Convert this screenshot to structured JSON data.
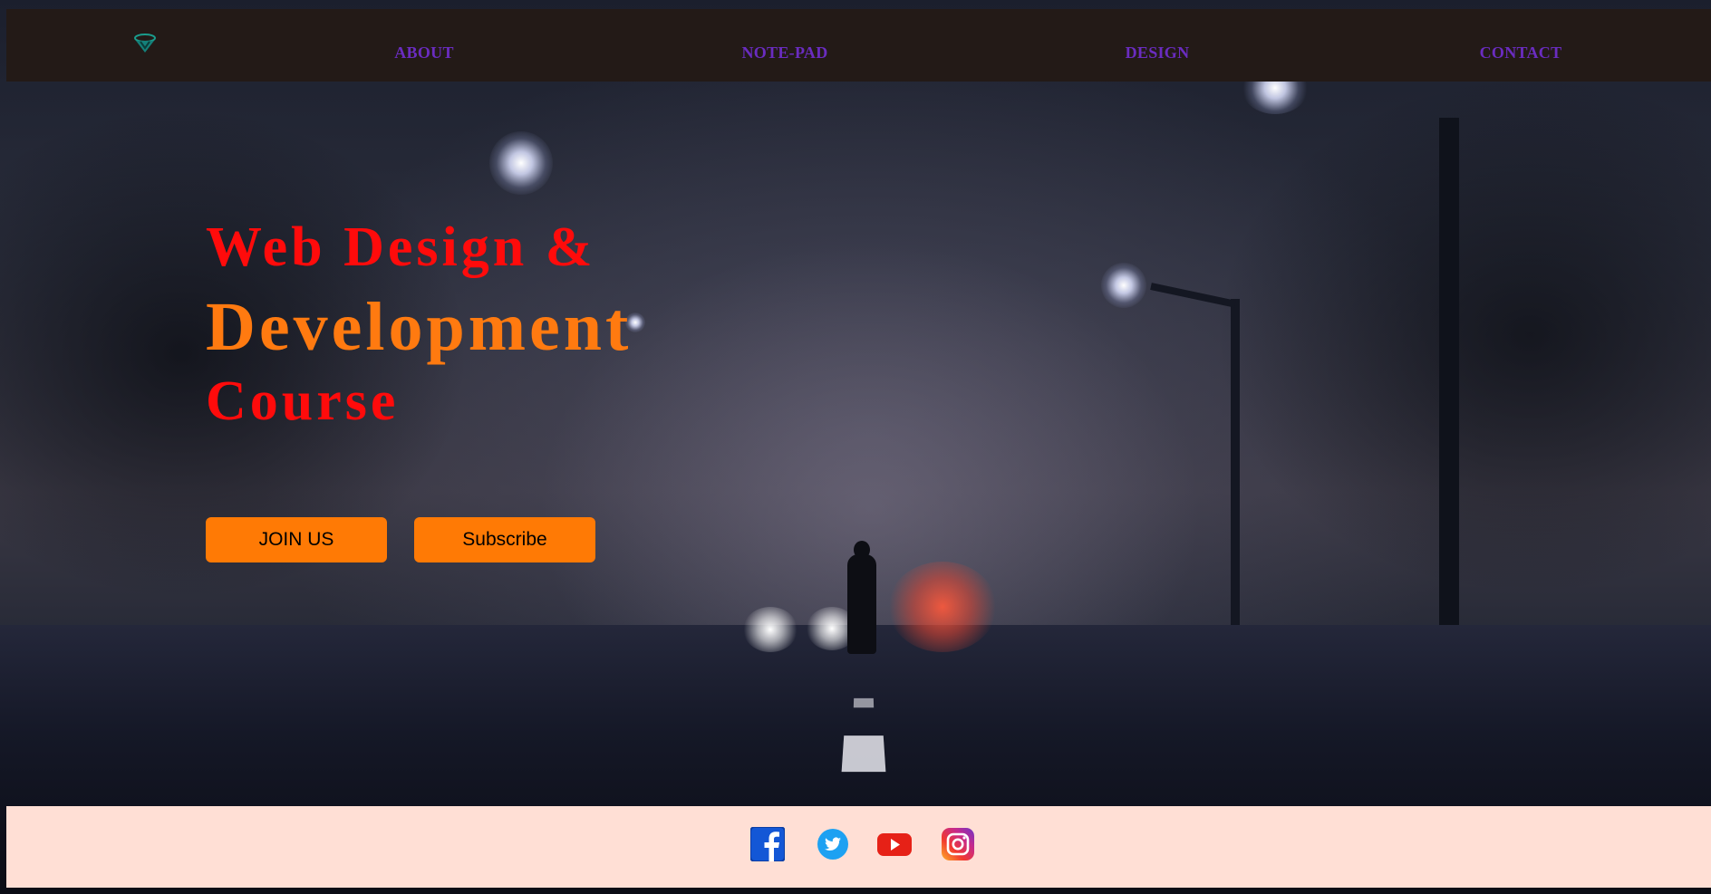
{
  "nav": {
    "logo_icon": "brand-logo-icon",
    "items": [
      {
        "label": "ABOUT"
      },
      {
        "label": "NOTE-PAD"
      },
      {
        "label": "DESIGN"
      },
      {
        "label": "CONTACT"
      }
    ]
  },
  "hero": {
    "line1": "Web Design &",
    "line2": "Development",
    "line3": "Course",
    "join_label": "JOIN US",
    "subscribe_label": "Subscribe"
  },
  "footer": {
    "social": [
      {
        "icon": "facebook-icon"
      },
      {
        "icon": "twitter-icon"
      },
      {
        "icon": "youtube-icon"
      },
      {
        "icon": "instagram-icon"
      }
    ]
  },
  "colors": {
    "nav_bg": "#231a17",
    "nav_text": "#6a2cc0",
    "title_red": "#ff0b0b",
    "title_orange": "#ff7a10",
    "button_bg": "#ff7a05",
    "footer_bg": "#ffdfd5"
  }
}
